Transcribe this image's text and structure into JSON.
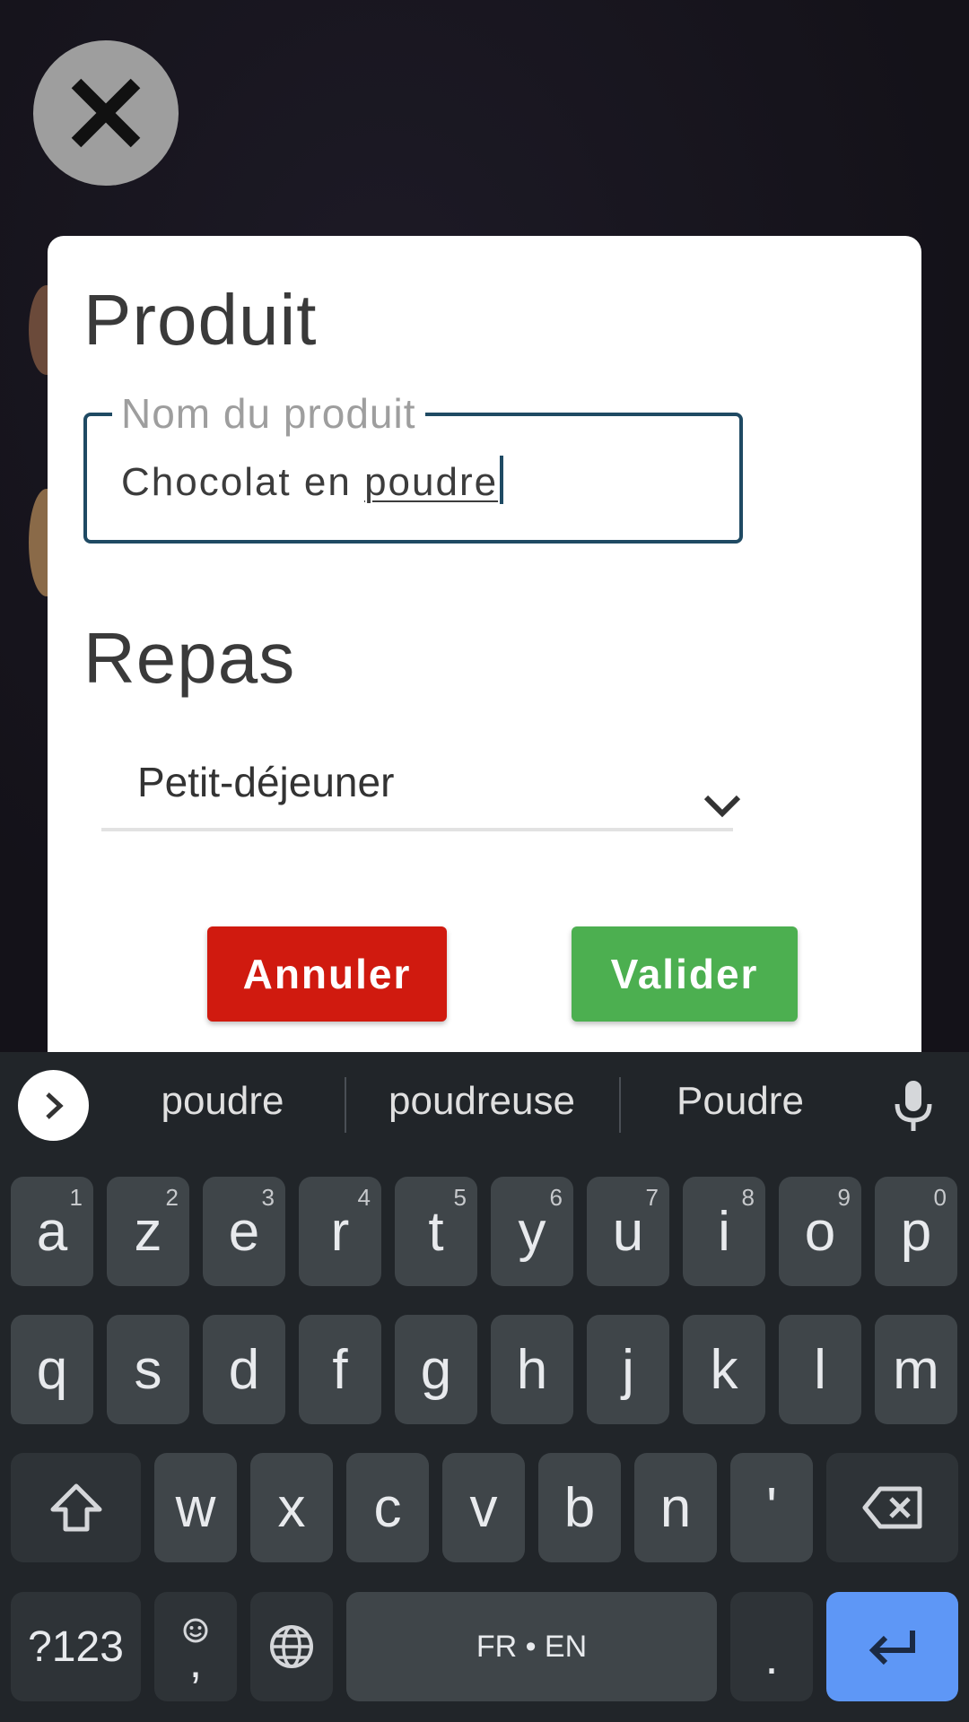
{
  "dialog": {
    "product_heading": "Produit",
    "name_field": {
      "label": "Nom du produit",
      "value_plain": "Chocolat en ",
      "value_composing": "poudre"
    },
    "meal_heading": "Repas",
    "meal_select": {
      "selected": "Petit-déjeuner"
    },
    "cancel_label": "Annuler",
    "ok_label": "Valider"
  },
  "colors": {
    "cancel": "#d01a0f",
    "ok": "#4caf50",
    "field_border": "#1f4a63",
    "enter_key": "#5e97f6"
  },
  "keyboard": {
    "suggestions": [
      "poudre",
      "poudreuse",
      "Poudre"
    ],
    "row1": [
      {
        "k": "a",
        "h": "1"
      },
      {
        "k": "z",
        "h": "2"
      },
      {
        "k": "e",
        "h": "3"
      },
      {
        "k": "r",
        "h": "4"
      },
      {
        "k": "t",
        "h": "5"
      },
      {
        "k": "y",
        "h": "6"
      },
      {
        "k": "u",
        "h": "7"
      },
      {
        "k": "i",
        "h": "8"
      },
      {
        "k": "o",
        "h": "9"
      },
      {
        "k": "p",
        "h": "0"
      }
    ],
    "row2": [
      "q",
      "s",
      "d",
      "f",
      "g",
      "h",
      "j",
      "k",
      "l",
      "m"
    ],
    "row3": [
      "w",
      "x",
      "c",
      "v",
      "b",
      "n",
      "'"
    ],
    "symbols_label": "?123",
    "comma_label": ",",
    "space_label": "FR • EN",
    "period_label": ".",
    "icons": [
      "close-icon",
      "chevron-down-icon",
      "chevron-right-icon",
      "microphone-icon",
      "shift-icon",
      "backspace-icon",
      "emoji-icon",
      "globe-icon",
      "enter-icon"
    ]
  }
}
